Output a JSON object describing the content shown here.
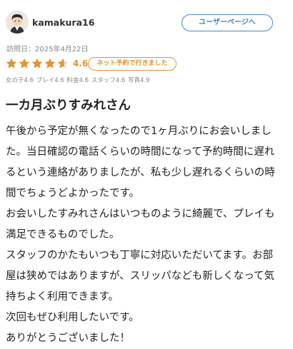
{
  "user": {
    "name": "kamakura16",
    "user_page_button": "ユーザーページへ"
  },
  "visit_date": "訪問日：2025年4月22日",
  "rating": {
    "value": 4.6,
    "score_text": "4.6",
    "badge": "ネット予約で行きました",
    "star_color": "#e0952f"
  },
  "subscores": [
    "女の子4.6",
    "プレイ4.6",
    "料金4.6",
    "スタッフ4.6",
    "写真4.9"
  ],
  "review": {
    "title": "一カ月ぶりすみれさん",
    "lines": [
      "午後から予定が無くなったので1ヶ月ぶりにお会いしまし",
      "た。当日確認の電話くらいの時間になって予約時間に遅れ",
      "るという連絡がありましたが、私も少し遅れるくらいの時",
      "間でちょうどよかったです。",
      "お会いしたすみれさんはいつものように綺麗で、プレイも",
      "満足できるものでした。",
      "スタッフのかたもいつも丁寧に対応いただいてます。お部",
      "屋は狭めではありますが、スリッパなども新しくなって気",
      "持ちよく利用できます。",
      "次回もぜひ利用したいです。",
      "ありがとうございました！"
    ]
  }
}
